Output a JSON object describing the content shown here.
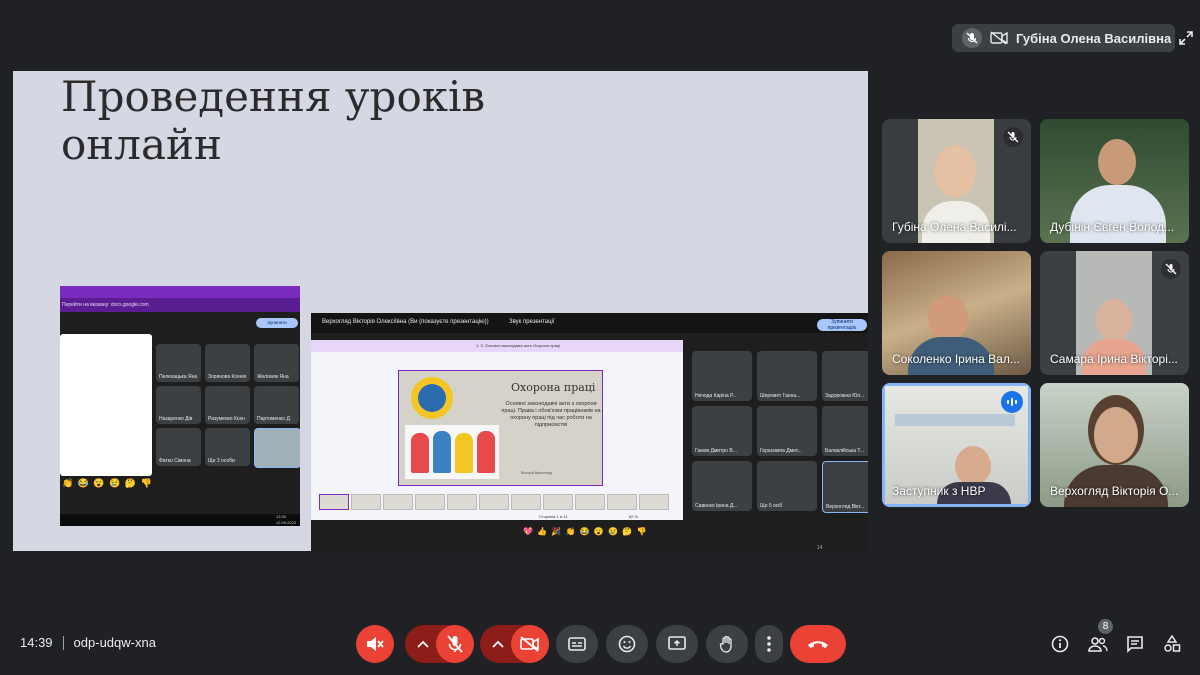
{
  "presenter_chip": {
    "name": "Губіна Олена Василівна"
  },
  "slide": {
    "title_line1": "Проведення уроків",
    "title_line2": "онлайн"
  },
  "embedded": {
    "url": "Перейти на вказану: docs.google.com",
    "stop_btn": "Зупинити презентацію",
    "left_people": [
      "Пелехацька Яна",
      "Зорянова Ксенія",
      "Желізняк Яна",
      "Назаренко Дів",
      "Разуменко Ксен",
      "Партоменко Д",
      "Фатко Сімона",
      "Ще 3 особи",
      ""
    ],
    "left_emoji": "👏 😂 😮 😢 🤔 👎",
    "left_time": "13:30",
    "left_date": "12.09.2023",
    "presenting": "Верхогляд Вікторія Олексіївна (Ви (показуєте презентацію))",
    "audio": "Звук презентації",
    "stop_btn2": "Зупинити презентацію",
    "doc_title": "1. 3. Основні законодавчі акти Охорона праці",
    "inner_slide": {
      "heading": "Охорона праці",
      "body": "Основні законодавчі акти з охорони праці. Права і обов'язки працівників на охорону праці під час роботи на підприємстві",
      "author": "Вікторія Верхогляд"
    },
    "page_label": "Сторінка 1 із 11",
    "zoom": "62 %",
    "right_people": [
      "Нечода Каріна Р...",
      "Шеремет Ганна...",
      "Задорожна Юл...",
      "Гамов Дмитро В...",
      "Герасимов Дмит...",
      "Балаклійська Т...",
      "Савенко Ірина Д...",
      "Ще 5 осіб",
      "Верхогляд Вікт..."
    ],
    "bottom_emoji": "💖 👍 🎉 👏 😂 😮 😢 🤔 👎",
    "bottom_count": "14"
  },
  "tiles": [
    {
      "name": "Губіна Олена Василі..."
    },
    {
      "name": "Дубінін Євген Волод..."
    },
    {
      "name": "Соколенко Ірина Вал..."
    },
    {
      "name": "Самара Ірина Вікторі..."
    },
    {
      "name": "Заступник з НВР"
    },
    {
      "name": "Верхогляд Вікторія О..."
    }
  ],
  "footer": {
    "time": "14:39",
    "meeting_code": "odp-udqw-xna",
    "participants_count": "8"
  },
  "colors": {
    "accent": "#8ab4f8",
    "danger": "#ea4335",
    "bar": "#202124",
    "chip": "#3c4043"
  }
}
